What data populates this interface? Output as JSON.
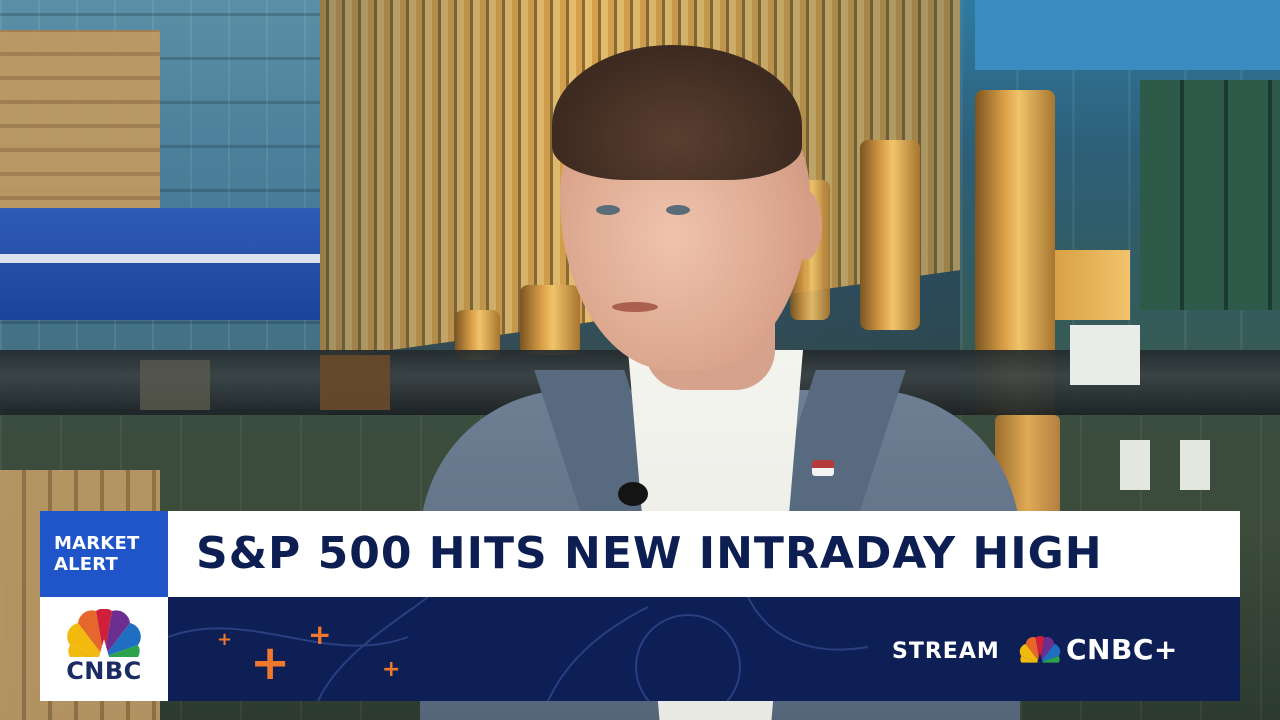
{
  "banner": {
    "alert_label_line1": "MARKET",
    "alert_label_line2": "ALERT",
    "headline": "S&P 500 HITS NEW INTRADAY HIGH",
    "network_logo_text": "CNBC",
    "stream_label": "STREAM",
    "stream_brand": "CNBC+"
  },
  "colors": {
    "alert_blue": "#1f55c9",
    "headline_navy": "#0d1f52",
    "ticker_navy": "#0e1f55",
    "accent_orange": "#f0782c"
  },
  "icons": [
    "cnbc-peacock-icon",
    "cnbc-peacock-small-icon",
    "plus-decoration-icon"
  ]
}
